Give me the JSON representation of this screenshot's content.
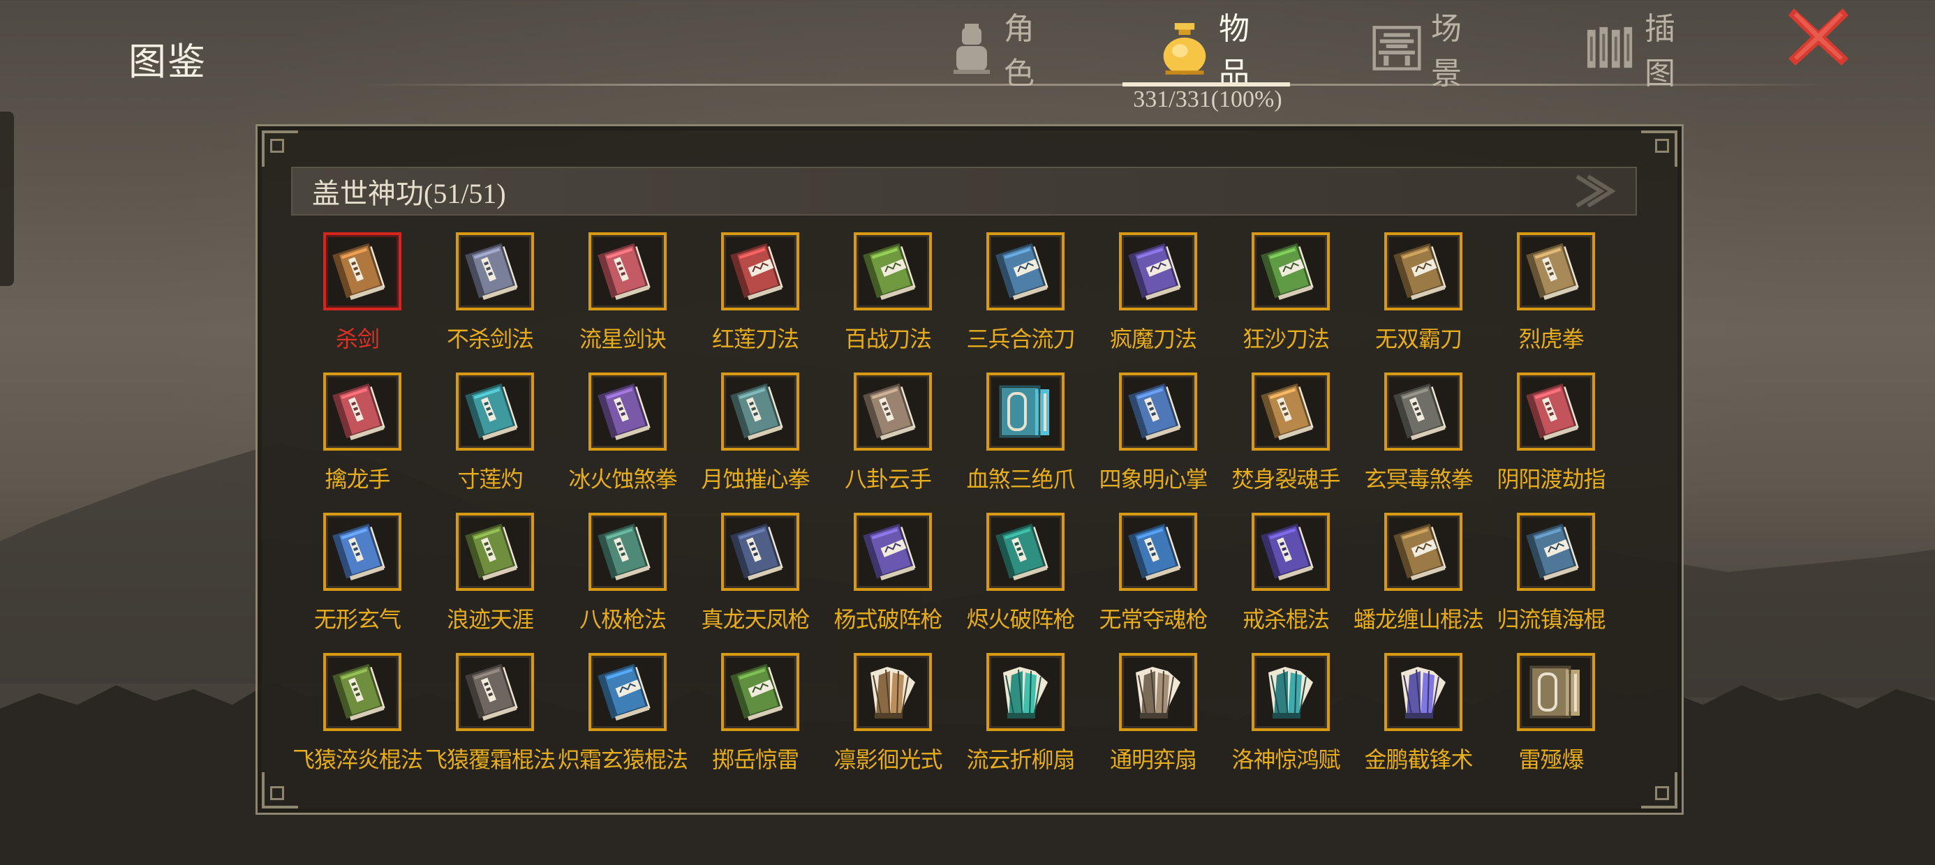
{
  "header": {
    "title": "图鉴",
    "tabs": [
      {
        "label": "角色",
        "icon": "character-icon"
      },
      {
        "label": "物品",
        "icon": "money-bag-icon",
        "active": true
      },
      {
        "label": "场景",
        "icon": "scene-icon"
      },
      {
        "label": "插图",
        "icon": "illustration-icon"
      }
    ],
    "progress": "331/331(100%)"
  },
  "section": {
    "title": "盖世神功(51/51)"
  },
  "colors": {
    "slot_border": "#d79a12",
    "selected_border": "#d4261e",
    "item_name": "#e7ad1d",
    "selected_name": "#e03025"
  },
  "items": [
    {
      "name": "杀剑",
      "cover": "#b0773e",
      "kind": "book",
      "selected": true
    },
    {
      "name": "不杀剑法",
      "cover": "#7a7f9a",
      "kind": "book"
    },
    {
      "name": "流星剑诀",
      "cover": "#c45a63",
      "kind": "book"
    },
    {
      "name": "红莲刀法",
      "cover": "#b84a48",
      "kind": "book-seal"
    },
    {
      "name": "百战刀法",
      "cover": "#6f9a3f",
      "kind": "book-seal"
    },
    {
      "name": "三兵合流刀",
      "cover": "#4d7fa8",
      "kind": "book-seal"
    },
    {
      "name": "疯魔刀法",
      "cover": "#6a58b0",
      "kind": "book-seal"
    },
    {
      "name": "狂沙刀法",
      "cover": "#5f9a45",
      "kind": "book-seal"
    },
    {
      "name": "无双霸刀",
      "cover": "#9b7a45",
      "kind": "book-seal"
    },
    {
      "name": "烈虎拳",
      "cover": "#a88a58",
      "kind": "book"
    },
    {
      "name": "擒龙手",
      "cover": "#c4545c",
      "kind": "book"
    },
    {
      "name": "寸莲灼",
      "cover": "#3f9aa0",
      "kind": "book"
    },
    {
      "name": "冰火蚀煞拳",
      "cover": "#7a5aa8",
      "kind": "book"
    },
    {
      "name": "月蚀摧心拳",
      "cover": "#5f8a8a",
      "kind": "book"
    },
    {
      "name": "八卦云手",
      "cover": "#9a8470",
      "kind": "book"
    },
    {
      "name": "血煞三绝爪",
      "cover": "#3f8fa0",
      "kind": "scroll"
    },
    {
      "name": "四象明心掌",
      "cover": "#4f78b8",
      "kind": "book"
    },
    {
      "name": "焚身裂魂手",
      "cover": "#b8884a",
      "kind": "book"
    },
    {
      "name": "玄冥毒煞拳",
      "cover": "#6f6f68",
      "kind": "book"
    },
    {
      "name": "阴阳渡劫指",
      "cover": "#c4545c",
      "kind": "book"
    },
    {
      "name": "无形玄气",
      "cover": "#4f7fc8",
      "kind": "book"
    },
    {
      "name": "浪迹天涯",
      "cover": "#6f8f3f",
      "kind": "book"
    },
    {
      "name": "八极枪法",
      "cover": "#4f8a78",
      "kind": "book"
    },
    {
      "name": "真龙天凤枪",
      "cover": "#4f5f88",
      "kind": "book"
    },
    {
      "name": "杨式破阵枪",
      "cover": "#6a58b0",
      "kind": "book-seal"
    },
    {
      "name": "烬火破阵枪",
      "cover": "#2f8f80",
      "kind": "book"
    },
    {
      "name": "无常夺魂枪",
      "cover": "#3f78b8",
      "kind": "book"
    },
    {
      "name": "戒杀棍法",
      "cover": "#5f4fb0",
      "kind": "book"
    },
    {
      "name": "蟠龙缠山棍法",
      "cover": "#9b7a45",
      "kind": "book-seal"
    },
    {
      "name": "归流镇海棍",
      "cover": "#4f7898",
      "kind": "book-seal"
    },
    {
      "name": "飞猿淬炎棍法",
      "cover": "#6f8f3f",
      "kind": "book"
    },
    {
      "name": "飞猿覆霜棍法",
      "cover": "#6f6660",
      "kind": "book"
    },
    {
      "name": "炽霜玄猿棍法",
      "cover": "#3f7fb8",
      "kind": "book-seal"
    },
    {
      "name": "掷岳惊雷",
      "cover": "#5f8f3f",
      "kind": "book-seal"
    },
    {
      "name": "凛影徊光式",
      "cover": "#8a6a45",
      "kind": "fan"
    },
    {
      "name": "流云折柳扇",
      "cover": "#2f8f80",
      "kind": "fan"
    },
    {
      "name": "通明弈扇",
      "cover": "#7a6a58",
      "kind": "fan"
    },
    {
      "name": "洛神惊鸿赋",
      "cover": "#2f7f80",
      "kind": "fan"
    },
    {
      "name": "金鹏截锋术",
      "cover": "#5f58a8",
      "kind": "fan"
    },
    {
      "name": "雷殛爆",
      "cover": "#8a7a58",
      "kind": "scroll"
    }
  ]
}
